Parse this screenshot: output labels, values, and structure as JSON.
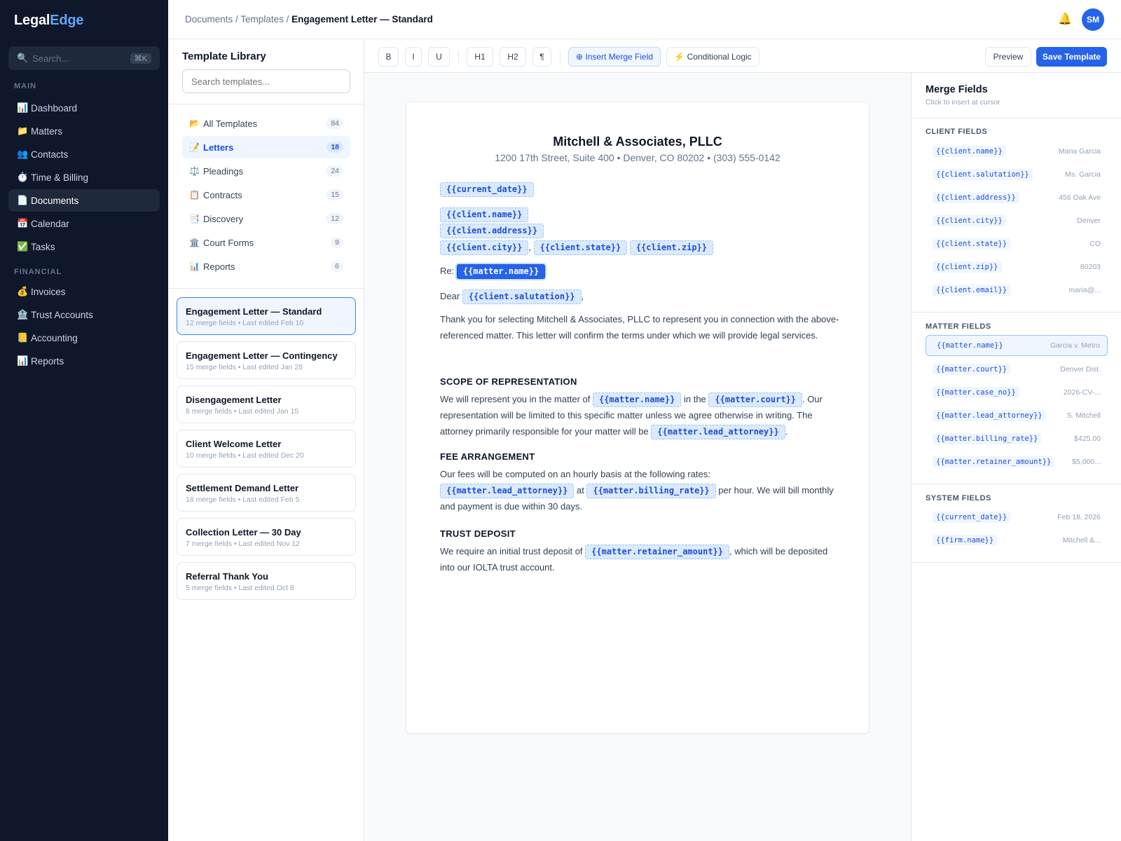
{
  "app": {
    "logo_a": "Legal",
    "logo_b": "Edge"
  },
  "sidebar": {
    "search_placeholder": "Search...",
    "search_shortcut": "⌘K",
    "main_label": "MAIN",
    "financial_label": "FINANCIAL",
    "main_items": [
      {
        "label": "Dashboard",
        "icon": "📊"
      },
      {
        "label": "Matters",
        "icon": "📁"
      },
      {
        "label": "Contacts",
        "icon": "👥"
      },
      {
        "label": "Time & Billing",
        "icon": "⏱️"
      },
      {
        "label": "Documents",
        "icon": "📄"
      },
      {
        "label": "Calendar",
        "icon": "📅"
      },
      {
        "label": "Tasks",
        "icon": "✅"
      }
    ],
    "financial_items": [
      {
        "label": "Invoices",
        "icon": "💰"
      },
      {
        "label": "Trust Accounts",
        "icon": "🏦"
      },
      {
        "label": "Accounting",
        "icon": "📒"
      },
      {
        "label": "Reports",
        "icon": "📊"
      }
    ]
  },
  "topbar": {
    "crumb_1": "Documents",
    "crumb_2": "Templates",
    "crumb_current": "Engagement Letter — Standard",
    "separator": " / ",
    "avatar": "SM",
    "bell_icon": "🔔"
  },
  "library": {
    "title": "Template Library",
    "search_placeholder": "Search templates...",
    "categories": [
      {
        "label": "All Templates",
        "icon": "📂",
        "count": "84"
      },
      {
        "label": "Letters",
        "icon": "📝",
        "count": "18"
      },
      {
        "label": "Pleadings",
        "icon": "⚖️",
        "count": "24"
      },
      {
        "label": "Contracts",
        "icon": "📋",
        "count": "15"
      },
      {
        "label": "Discovery",
        "icon": "📑",
        "count": "12"
      },
      {
        "label": "Court Forms",
        "icon": "🏛️",
        "count": "9"
      },
      {
        "label": "Reports",
        "icon": "📊",
        "count": "6"
      }
    ],
    "templates": [
      {
        "title": "Engagement Letter — Standard",
        "meta": "12 merge fields • Last edited Feb 10"
      },
      {
        "title": "Engagement Letter — Contingency",
        "meta": "15 merge fields • Last edited Jan 28"
      },
      {
        "title": "Disengagement Letter",
        "meta": "8 merge fields • Last edited Jan 15"
      },
      {
        "title": "Client Welcome Letter",
        "meta": "10 merge fields • Last edited Dec 20"
      },
      {
        "title": "Settlement Demand Letter",
        "meta": "18 merge fields • Last edited Feb 5"
      },
      {
        "title": "Collection Letter — 30 Day",
        "meta": "7 merge fields • Last edited Nov 12"
      },
      {
        "title": "Referral Thank You",
        "meta": "5 merge fields • Last edited Oct 8"
      }
    ]
  },
  "toolbar": {
    "bold": "B",
    "italic": "I",
    "underline": "U",
    "h1": "H1",
    "h2": "H2",
    "para": "¶",
    "insert_merge": "⊕ Insert Merge Field",
    "conditional": "⚡ Conditional Logic",
    "preview": "Preview",
    "save": "Save Template"
  },
  "document": {
    "firm_name": "Mitchell & Associates, PLLC",
    "firm_address": "1200 17th Street, Suite 400 • Denver, CO 80202 • (303) 555-0142",
    "f_current_date": "{{current_date}}",
    "f_client_name": "{{client.name}}",
    "f_client_address": "{{client.address}}",
    "f_client_city": "{{client.city}}",
    "f_client_state": "{{client.state}}",
    "f_client_zip": "{{client.zip}}",
    "f_matter_name": "{{matter.name}}",
    "f_client_salutation": "{{client.salutation}}",
    "f_matter_court": "{{matter.court}}",
    "f_matter_lead_attorney": "{{matter.lead_attorney}}",
    "f_matter_billing_rate": "{{matter.billing_rate}}",
    "f_matter_retainer_amount": "{{matter.retainer_amount}}",
    "comma": ",",
    "re_label": "Re:",
    "dear_label": "Dear",
    "intro": "Thank you for selecting Mitchell & Associates, PLLC to represent you in connection with the above-referenced matter. This letter will confirm the terms under which we will provide legal services.",
    "scope_heading": "SCOPE OF REPRESENTATION",
    "scope_a": "We will represent you in the matter of",
    "scope_b": "in the",
    "scope_c": ". Our representation will be limited to this specific matter unless we agree otherwise in writing. The attorney primarily responsible for your matter will be",
    "period": ".",
    "fee_heading": "FEE ARRANGEMENT",
    "fee_a": "Our fees will be computed on an hourly basis at the following rates:",
    "fee_at": "at",
    "fee_b": "per hour. We will bill monthly and payment is due within 30 days.",
    "trust_heading": "TRUST DEPOSIT",
    "trust_a": "We require an initial trust deposit of",
    "trust_b": ", which will be deposited into our IOLTA trust account."
  },
  "merge_panel": {
    "title": "Merge Fields",
    "subtitle": "Click to insert at cursor",
    "client_label": "CLIENT FIELDS",
    "matter_label": "MATTER FIELDS",
    "system_label": "SYSTEM FIELDS",
    "client_fields": [
      {
        "code": "{{client.name}}",
        "value": "Maria Garcia"
      },
      {
        "code": "{{client.salutation}}",
        "value": "Ms. Garcia"
      },
      {
        "code": "{{client.address}}",
        "value": "456 Oak Ave"
      },
      {
        "code": "{{client.city}}",
        "value": "Denver"
      },
      {
        "code": "{{client.state}}",
        "value": "CO"
      },
      {
        "code": "{{client.zip}}",
        "value": "80203"
      },
      {
        "code": "{{client.email}}",
        "value": "maria@..."
      }
    ],
    "matter_fields": [
      {
        "code": "{{matter.name}}",
        "value": "Garcia v. Metro"
      },
      {
        "code": "{{matter.court}}",
        "value": "Denver Dist."
      },
      {
        "code": "{{matter.case_no}}",
        "value": "2026-CV-..."
      },
      {
        "code": "{{matter.lead_attorney}}",
        "value": "S. Mitchell"
      },
      {
        "code": "{{matter.billing_rate}}",
        "value": "$425.00"
      },
      {
        "code": "{{matter.retainer_amount}}",
        "value": "$5,000..."
      }
    ],
    "system_fields": [
      {
        "code": "{{current_date}}",
        "value": "Feb 18, 2026"
      },
      {
        "code": "{{firm.name}}",
        "value": "Mitchell &..."
      }
    ]
  }
}
